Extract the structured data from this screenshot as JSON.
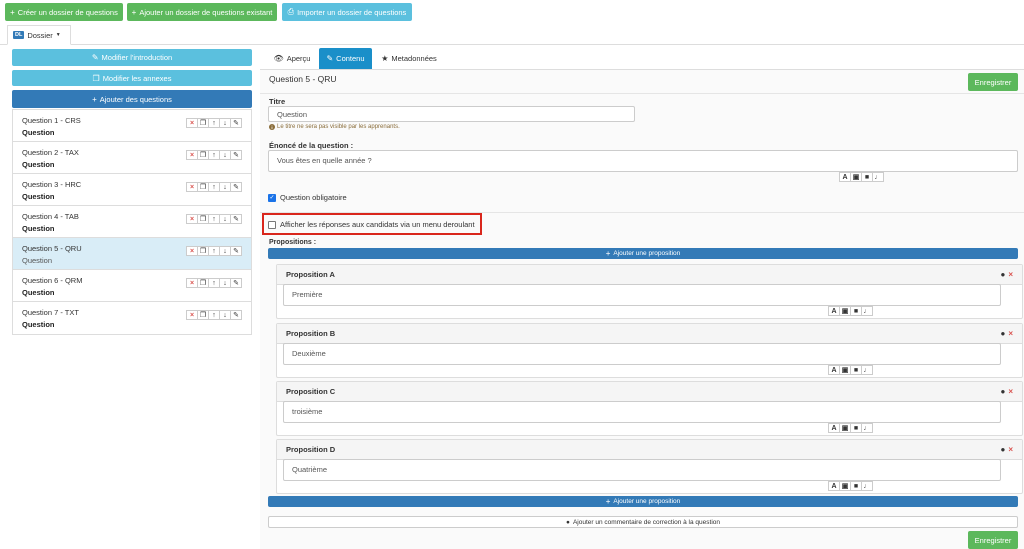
{
  "toolbar": {
    "create_label": "Créer un dossier de questions",
    "add_existing_label": "Ajouter un dossier de questions existant",
    "import_label": "Importer un dossier de questions"
  },
  "dossier_tab": {
    "badge": "DL",
    "label": "Dossier"
  },
  "sidebar": {
    "intro_label": "Modifier l'introduction",
    "annex_label": "Modifier les annexes",
    "add_questions_label": "Ajouter des questions",
    "questions": [
      {
        "title": "Question 1 - CRS",
        "sub": "Question"
      },
      {
        "title": "Question 2 - TAX",
        "sub": "Question"
      },
      {
        "title": "Question 3 - HRC",
        "sub": "Question"
      },
      {
        "title": "Question 4 - TAB",
        "sub": "Question"
      },
      {
        "title": "Question 5 - QRU",
        "sub": "Question"
      },
      {
        "title": "Question 6 - QRM",
        "sub": "Question"
      },
      {
        "title": "Question 7 - TXT",
        "sub": "Question"
      }
    ],
    "selected_index": 4
  },
  "tabs": {
    "apercu": "Aperçu",
    "contenu": "Contenu",
    "metadonnees": "Metadonnées",
    "active": "contenu"
  },
  "main": {
    "question_title": "Question 5 - QRU",
    "save_label": "Enregistrer",
    "titre_label": "Titre",
    "titre_value": "Question",
    "titre_hint": "Le titre ne sera pas visible par les apprenants.",
    "enonce_label": "Énoncé de la question :",
    "enonce_value": "Vous êtes en quelle année ?",
    "obligatoire_label": "Question obligatoire",
    "obligatoire_checked": true,
    "menu_deroulant_label": "Afficher les réponses aux candidats via un menu deroulant",
    "menu_deroulant_checked": false,
    "propositions_label": "Propositions :",
    "add_proposition_label": "Ajouter une proposition",
    "propositions": [
      {
        "label": "Proposition A",
        "value": "Première"
      },
      {
        "label": "Proposition B",
        "value": "Deuxième"
      },
      {
        "label": "Proposition C",
        "value": "troisième"
      },
      {
        "label": "Proposition D",
        "value": "Quatrième"
      }
    ],
    "comment_label": "Ajouter un commentaire de correction à la question"
  },
  "colors": {
    "green": "#5cb85c",
    "light_blue": "#5bc0de",
    "dark_blue": "#337ab7",
    "highlight_red": "#d9261c"
  }
}
